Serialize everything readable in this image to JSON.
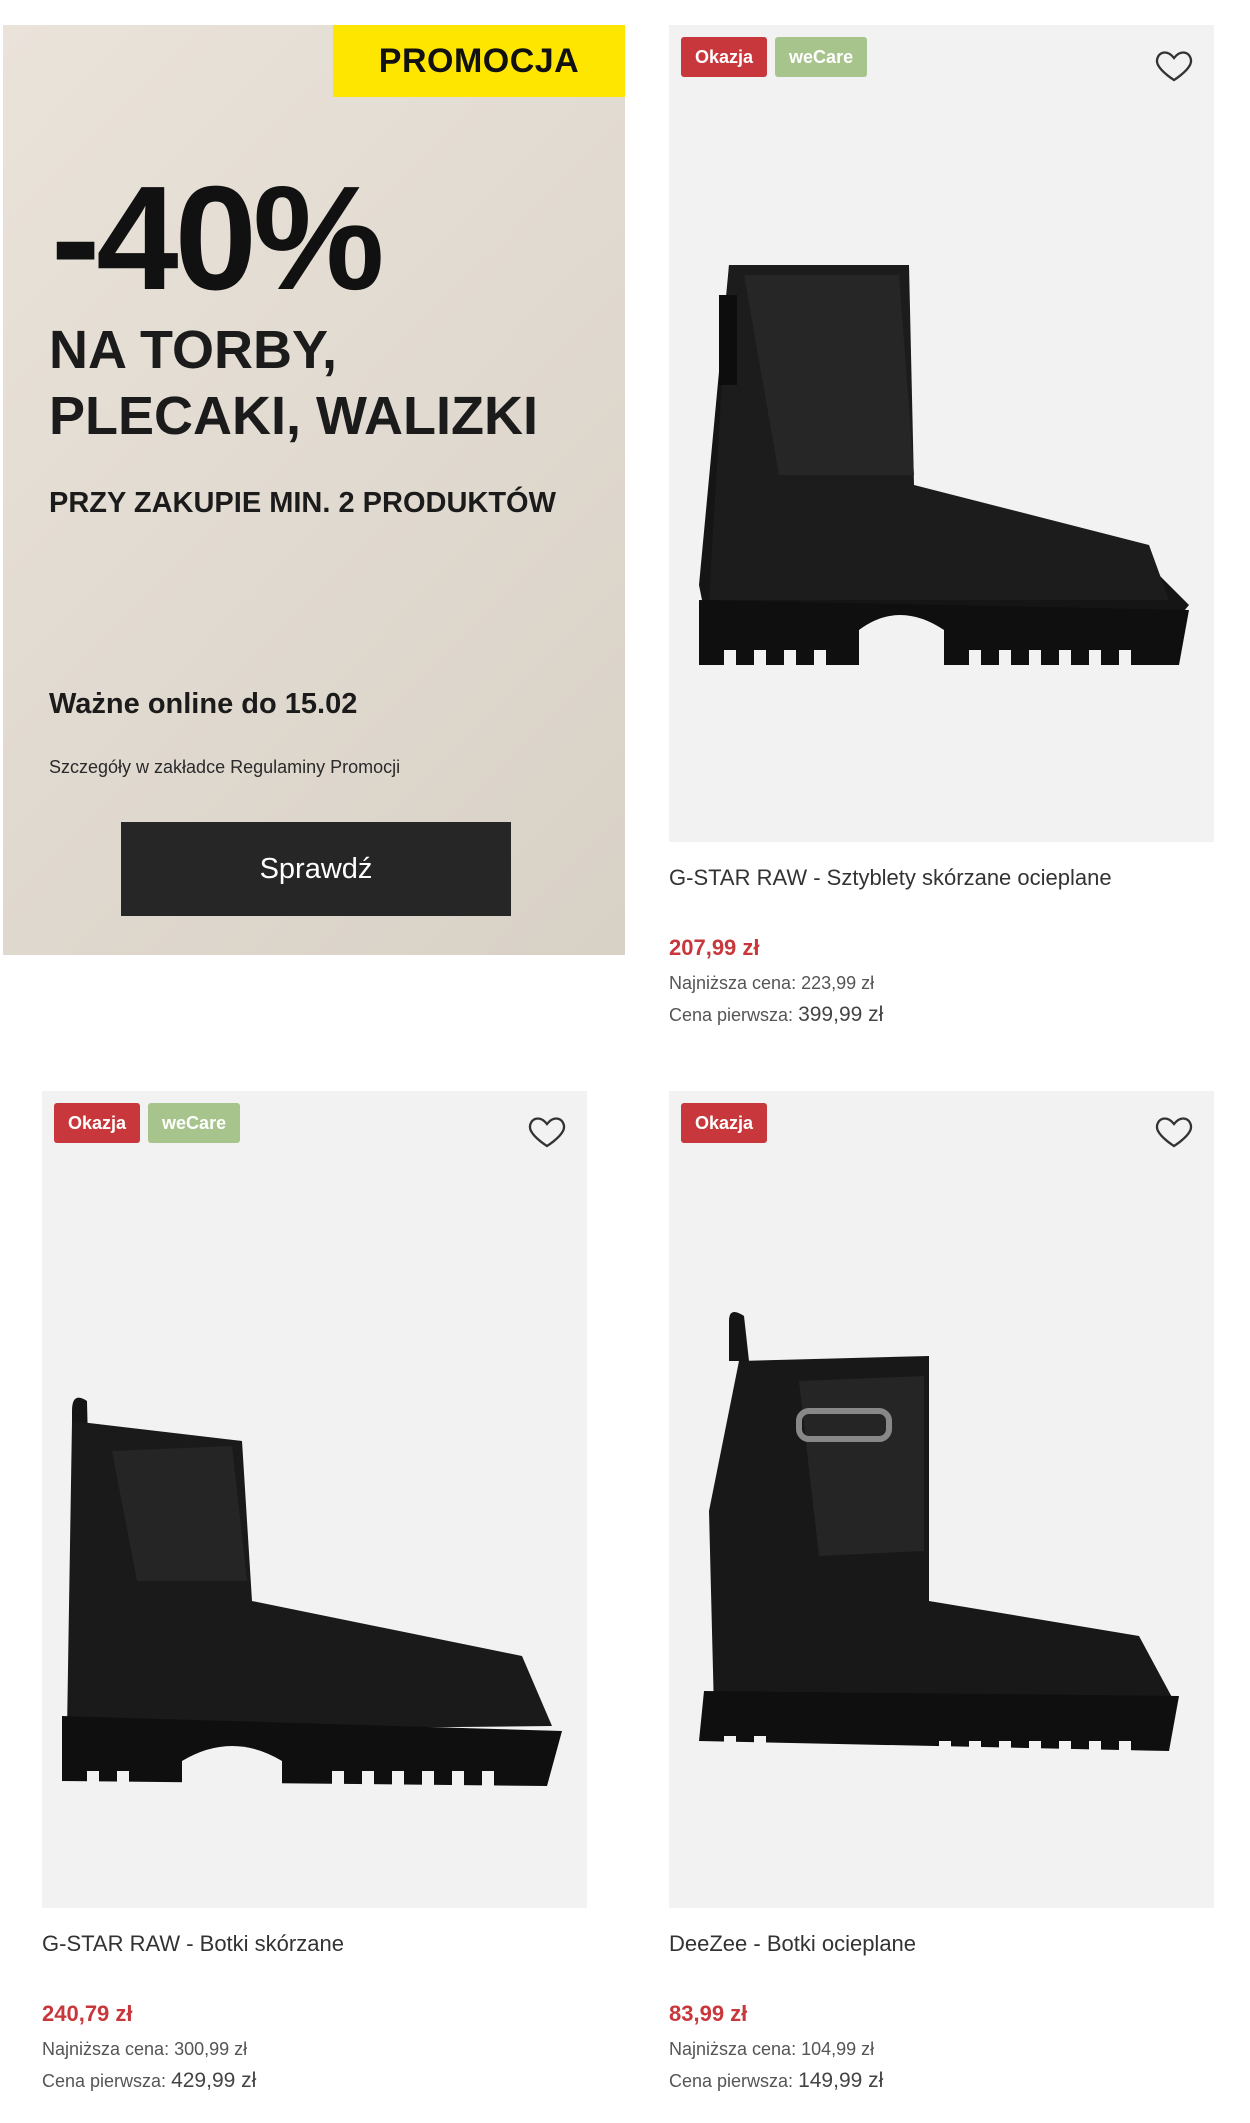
{
  "promo": {
    "badge": "PROMOCJA",
    "discount": "-40%",
    "headline_line1": "NA TORBY,",
    "headline_line2": "PLECAKI, WALIZKI",
    "condition": "PRZY ZAKUPIE MIN. 2 PRODUKTÓW",
    "validity": "Ważne online do 15.02",
    "terms": "Szczegóły w zakładce Regulaminy Promocji",
    "button_label": "Sprawdź",
    "badge_color": "#ffe600"
  },
  "labels": {
    "lowest_price": "Najniższa cena:",
    "first_price": "Cena pierwsza:"
  },
  "products": [
    {
      "badges": [
        "Okazja",
        "weCare"
      ],
      "name": "G-STAR RAW - Sztyblety skórzane ocieplane",
      "price": "207,99 zł",
      "lowest_price": "223,99 zł",
      "first_price": "399,99 zł",
      "icon": "heart-outline-icon"
    },
    {
      "badges": [
        "Okazja",
        "weCare"
      ],
      "name": "G-STAR RAW - Botki skórzane",
      "price": "240,79 zł",
      "lowest_price": "300,99 zł",
      "first_price": "429,99 zł",
      "icon": "heart-outline-icon"
    },
    {
      "badges": [
        "Okazja"
      ],
      "name": "DeeZee - Botki ocieplane",
      "price": "83,99 zł",
      "lowest_price": "104,99 zł",
      "first_price": "149,99 zł",
      "icon": "heart-outline-icon"
    }
  ],
  "colors": {
    "sale_price": "#c8373b",
    "okazja_badge": "#c8373b",
    "wecare_badge": "#a7c48d"
  }
}
